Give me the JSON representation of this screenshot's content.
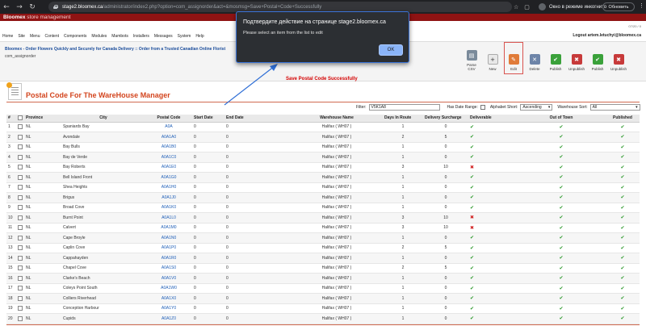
{
  "browser": {
    "host": "stage2.bloomex.ca",
    "path": "/administrator/index2.php?option=com_assignorder&act=&mosmsg=Save+Postal+Code+Successfully",
    "incognito_label": "Окно в режиме инкогнито",
    "update_label": "Обновить"
  },
  "app": {
    "brand": "Bloomex",
    "subtitle": "store management",
    "date": "07/20 / 0"
  },
  "menu": {
    "items": [
      "Home",
      "Site",
      "Menu",
      "Content",
      "Components",
      "Modules",
      "Mambots",
      "Installers",
      "Messages",
      "System",
      "Help"
    ],
    "logout": "Logout artem.letuchyi@bloomex.ca"
  },
  "breadcrumb": "Bloomex - Order Flowers Quickly and Securely for Canada Delivery :: Order from a Trusted Canadian Online Florist",
  "component_name": "com_assignorder",
  "toolbar": {
    "parse_csv": "Parse CSV",
    "new": "New",
    "edit": "Edit",
    "delete": "Delete",
    "publish": "Publish",
    "unpublish": "Unpublish"
  },
  "message": "Save Postal Code Successfully",
  "page_title": "Postal Code For The WareHouse Manager",
  "filters": {
    "filter_label": "Filter:",
    "filter_value": "V5K1A8",
    "date_range_label": "Has Date Range:",
    "alpha_label": "Alphabet Short:",
    "alpha_value": "Ascending",
    "warehouse_label": "Warehouse Sort:",
    "warehouse_value": "All"
  },
  "table": {
    "headers": [
      "#",
      "",
      "Province",
      "City",
      "Postal Code",
      "Start Date",
      "End Date",
      "Warehouse Name",
      "Days In Route",
      "Delivery Surcharge",
      "Deliverable",
      "Out of Town",
      "Published"
    ],
    "rows": [
      {
        "n": "1",
        "province": "NL",
        "city": "Spaniards Bay",
        "postal": "A0A",
        "start": "0",
        "end": "0",
        "warehouse": "Halifax ( WH07 )",
        "days": "1",
        "surcharge": "0",
        "deliverable": true,
        "outoftown": true,
        "published": true
      },
      {
        "n": "2",
        "province": "NL",
        "city": "Avondale",
        "postal": "A0A1A0",
        "start": "0",
        "end": "0",
        "warehouse": "Halifax ( WH07 )",
        "days": "2",
        "surcharge": "5",
        "deliverable": true,
        "outoftown": true,
        "published": true
      },
      {
        "n": "3",
        "province": "NL",
        "city": "Bay Bulls",
        "postal": "A0A1B0",
        "start": "0",
        "end": "0",
        "warehouse": "Halifax ( WH07 )",
        "days": "1",
        "surcharge": "0",
        "deliverable": true,
        "outoftown": true,
        "published": true
      },
      {
        "n": "4",
        "province": "NL",
        "city": "Bay de Verde",
        "postal": "A0A1C0",
        "start": "0",
        "end": "0",
        "warehouse": "Halifax ( WH07 )",
        "days": "1",
        "surcharge": "0",
        "deliverable": true,
        "outoftown": true,
        "published": true
      },
      {
        "n": "5",
        "province": "NL",
        "city": "Bay Roberts",
        "postal": "A0A1E0",
        "start": "0",
        "end": "0",
        "warehouse": "Halifax ( WH07 )",
        "days": "3",
        "surcharge": "10",
        "deliverable": false,
        "outoftown": true,
        "published": true
      },
      {
        "n": "6",
        "province": "NL",
        "city": "Bell Island Front",
        "postal": "A0A1G0",
        "start": "0",
        "end": "0",
        "warehouse": "Halifax ( WH07 )",
        "days": "1",
        "surcharge": "0",
        "deliverable": true,
        "outoftown": true,
        "published": true
      },
      {
        "n": "7",
        "province": "NL",
        "city": "Shea Heights",
        "postal": "A0A1H0",
        "start": "0",
        "end": "0",
        "warehouse": "Halifax ( WH07 )",
        "days": "1",
        "surcharge": "0",
        "deliverable": true,
        "outoftown": true,
        "published": true
      },
      {
        "n": "8",
        "province": "NL",
        "city": "Brigus",
        "postal": "A0A1J0",
        "start": "0",
        "end": "0",
        "warehouse": "Halifax ( WH07 )",
        "days": "1",
        "surcharge": "0",
        "deliverable": true,
        "outoftown": true,
        "published": true
      },
      {
        "n": "9",
        "province": "NL",
        "city": "Broad Cove",
        "postal": "A0A1K0",
        "start": "0",
        "end": "0",
        "warehouse": "Halifax ( WH07 )",
        "days": "1",
        "surcharge": "0",
        "deliverable": true,
        "outoftown": true,
        "published": true
      },
      {
        "n": "10",
        "province": "NL",
        "city": "Burnt Point",
        "postal": "A0A1L0",
        "start": "0",
        "end": "0",
        "warehouse": "Halifax ( WH07 )",
        "days": "3",
        "surcharge": "10",
        "deliverable": false,
        "outoftown": true,
        "published": true
      },
      {
        "n": "11",
        "province": "NL",
        "city": "Calvert",
        "postal": "A0A1M0",
        "start": "0",
        "end": "0",
        "warehouse": "Halifax ( WH07 )",
        "days": "3",
        "surcharge": "10",
        "deliverable": false,
        "outoftown": true,
        "published": true
      },
      {
        "n": "12",
        "province": "NL",
        "city": "Cape Broyle",
        "postal": "A0A1N0",
        "start": "0",
        "end": "0",
        "warehouse": "Halifax ( WH07 )",
        "days": "1",
        "surcharge": "0",
        "deliverable": true,
        "outoftown": true,
        "published": true
      },
      {
        "n": "13",
        "province": "NL",
        "city": "Caplin Cove",
        "postal": "A0A1P0",
        "start": "0",
        "end": "0",
        "warehouse": "Halifax ( WH07 )",
        "days": "2",
        "surcharge": "5",
        "deliverable": true,
        "outoftown": true,
        "published": true
      },
      {
        "n": "14",
        "province": "NL",
        "city": "Cappahayden",
        "postal": "A0A1R0",
        "start": "0",
        "end": "0",
        "warehouse": "Halifax ( WH07 )",
        "days": "1",
        "surcharge": "0",
        "deliverable": true,
        "outoftown": true,
        "published": true
      },
      {
        "n": "15",
        "province": "NL",
        "city": "Chapel Cove",
        "postal": "A0A1S0",
        "start": "0",
        "end": "0",
        "warehouse": "Halifax ( WH07 )",
        "days": "2",
        "surcharge": "5",
        "deliverable": true,
        "outoftown": true,
        "published": true
      },
      {
        "n": "16",
        "province": "NL",
        "city": "Clarke's Beach",
        "postal": "A0A1V0",
        "start": "0",
        "end": "0",
        "warehouse": "Halifax ( WH07 )",
        "days": "1",
        "surcharge": "0",
        "deliverable": true,
        "outoftown": true,
        "published": true
      },
      {
        "n": "17",
        "province": "NL",
        "city": "Coleys Point South",
        "postal": "A0A1W0",
        "start": "0",
        "end": "0",
        "warehouse": "Halifax ( WH07 )",
        "days": "1",
        "surcharge": "0",
        "deliverable": true,
        "outoftown": true,
        "published": true
      },
      {
        "n": "18",
        "province": "NL",
        "city": "Colliers Riverhead",
        "postal": "A0A1X0",
        "start": "0",
        "end": "0",
        "warehouse": "Halifax ( WH07 )",
        "days": "1",
        "surcharge": "0",
        "deliverable": true,
        "outoftown": true,
        "published": true
      },
      {
        "n": "19",
        "province": "NL",
        "city": "Conception Harbour",
        "postal": "A0A1Y0",
        "start": "0",
        "end": "0",
        "warehouse": "Halifax ( WH07 )",
        "days": "1",
        "surcharge": "0",
        "deliverable": true,
        "outoftown": true,
        "published": true
      },
      {
        "n": "20",
        "province": "NL",
        "city": "Cupids",
        "postal": "A0A1Z0",
        "start": "0",
        "end": "0",
        "warehouse": "Halifax ( WH07 )",
        "days": "1",
        "surcharge": "0",
        "deliverable": true,
        "outoftown": true,
        "published": true
      }
    ]
  },
  "dialog": {
    "title": "Подтвердите действие на странице stage2.bloomex.ca",
    "message": "Please select an item from the list to edit",
    "ok_label": "OK"
  },
  "icons": {
    "tick": "✔",
    "cross": "✖"
  },
  "colors": {
    "brand": "#8f1313",
    "title": "#d3451e",
    "link": "#1f5fb8",
    "tick": "#2e9a2e",
    "cross": "#d11f1f",
    "dialog_button": "#8ab4f8"
  }
}
